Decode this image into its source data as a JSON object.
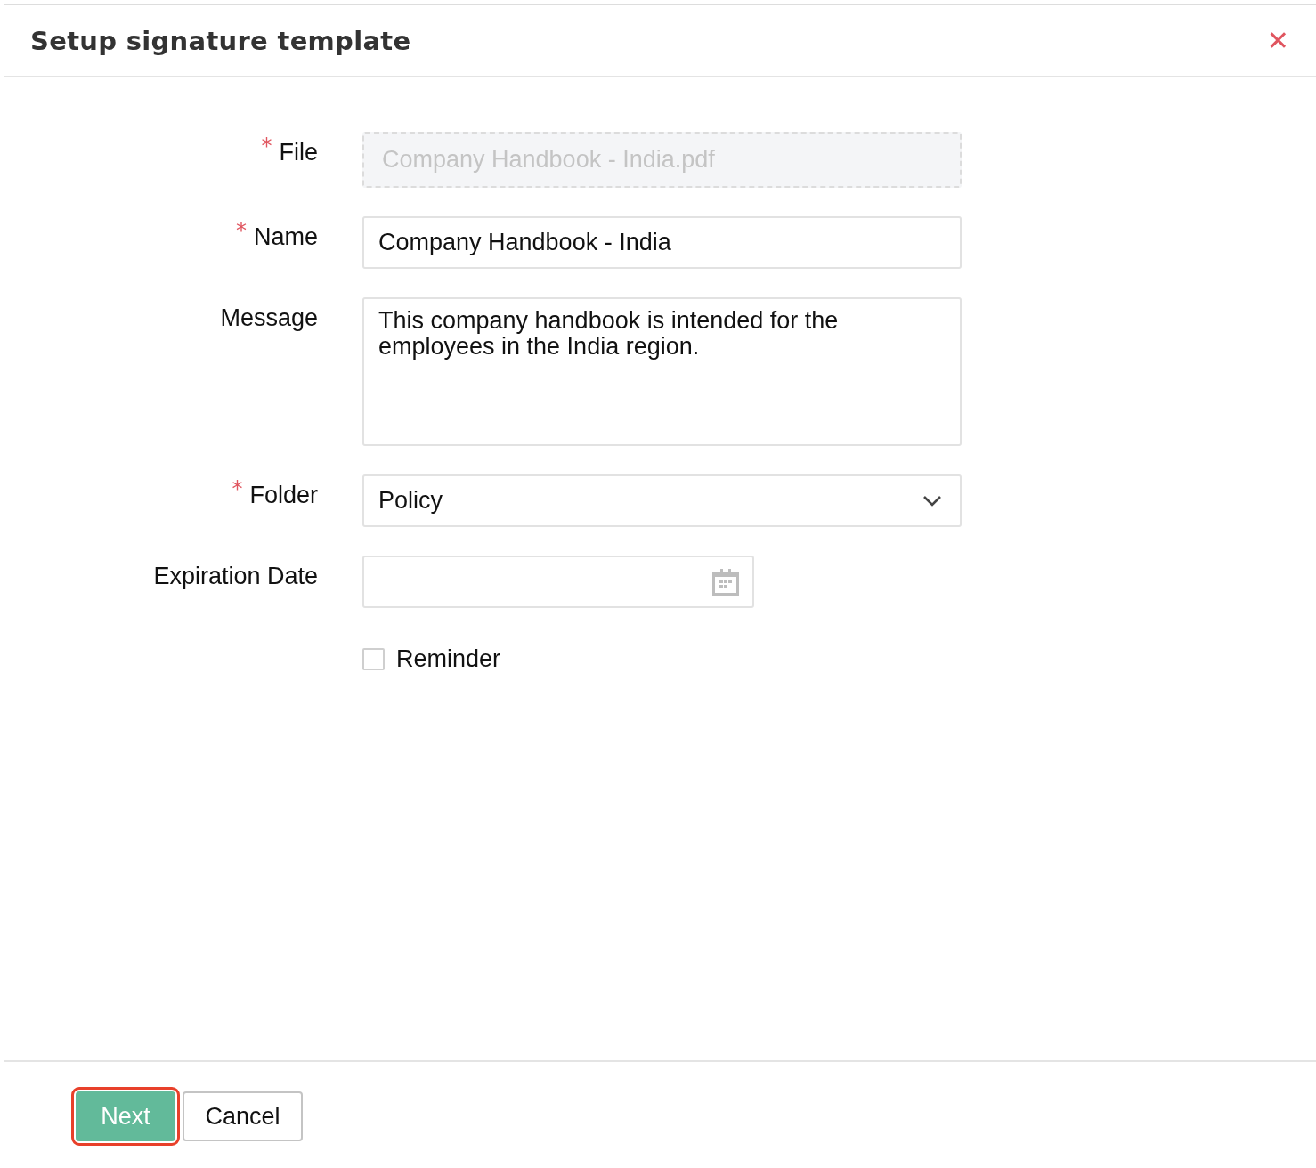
{
  "dialog": {
    "title": "Setup signature template",
    "close": "✕"
  },
  "required_mark": "*",
  "fields": [
    {
      "kind": "file",
      "label": "File",
      "required": true,
      "value": "Company Handbook - India.pdf",
      "disabled": true
    },
    {
      "kind": "text",
      "label": "Name",
      "required": true,
      "value": "Company Handbook - India"
    },
    {
      "kind": "textarea",
      "label": "Message",
      "required": false,
      "value": "This company handbook is intended for the employees in the India region."
    },
    {
      "kind": "select",
      "label": "Folder",
      "required": true,
      "value": "Policy"
    },
    {
      "kind": "date",
      "label": "Expiration Date",
      "required": false
    },
    {
      "kind": "checkbox",
      "label": "Reminder",
      "checked": false
    }
  ],
  "buttons": [
    {
      "kind": "primary",
      "label": "Next",
      "highlighted": true
    },
    {
      "kind": "secondary",
      "label": "Cancel",
      "highlighted": false
    }
  ]
}
